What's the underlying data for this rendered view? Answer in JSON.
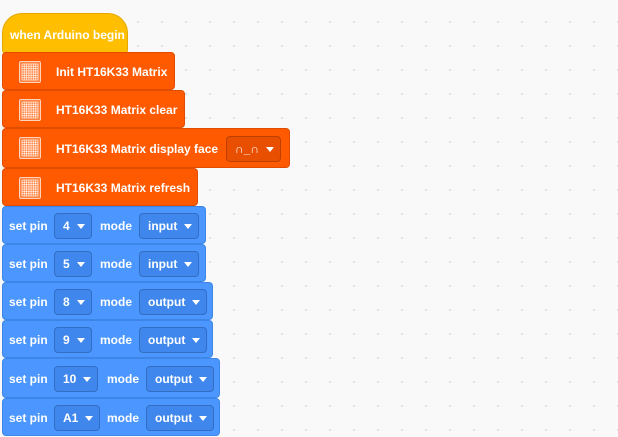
{
  "hat": {
    "label": "when Arduino begin"
  },
  "matrix_blocks": [
    {
      "label": "Init HT16K33 Matrix"
    },
    {
      "label": "HT16K33 Matrix clear"
    },
    {
      "label": "HT16K33 Matrix display face",
      "dropdown": "∩_∩"
    },
    {
      "label": "HT16K33 Matrix refresh"
    }
  ],
  "pin_blocks": [
    {
      "prefix": "set pin",
      "pin": "4",
      "mode_label": "mode",
      "mode": "input"
    },
    {
      "prefix": "set pin",
      "pin": "5",
      "mode_label": "mode",
      "mode": "input"
    },
    {
      "prefix": "set pin",
      "pin": "8",
      "mode_label": "mode",
      "mode": "output"
    },
    {
      "prefix": "set pin",
      "pin": "9",
      "mode_label": "mode",
      "mode": "output"
    },
    {
      "prefix": "set pin",
      "pin": "10",
      "mode_label": "mode",
      "mode": "output"
    },
    {
      "prefix": "set pin",
      "pin": "A1",
      "mode_label": "mode",
      "mode": "output"
    }
  ],
  "colors": {
    "event": "#ffbf00",
    "matrix": "#ff5a00",
    "pins": "#4c97ff"
  },
  "icons": {
    "matrix": "led-matrix-icon",
    "dropdown": "caret-down-icon"
  }
}
